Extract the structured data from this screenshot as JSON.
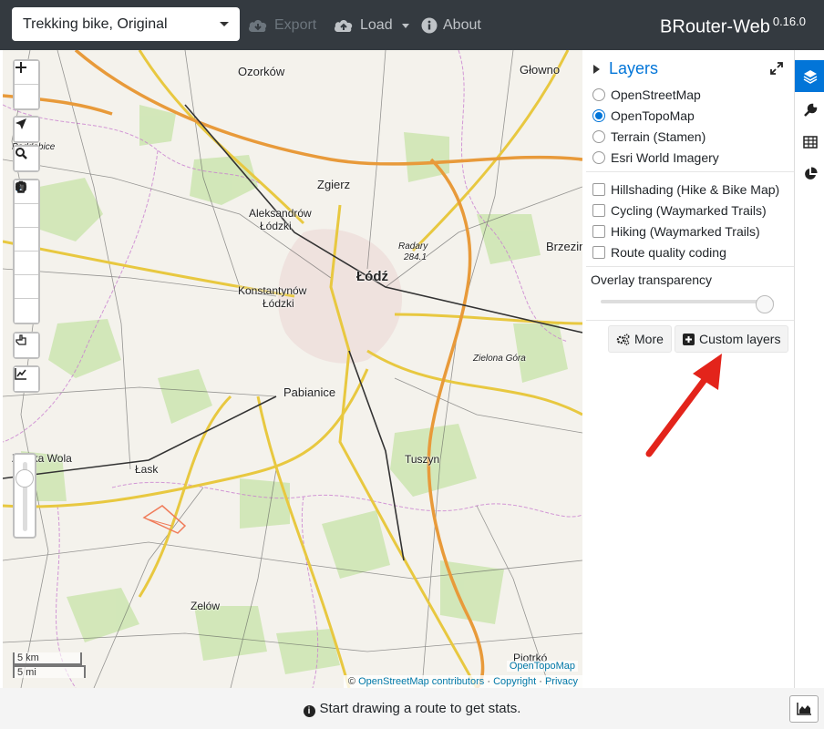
{
  "navbar": {
    "profile": "Trekking bike, Original",
    "export_label": "Export",
    "load_label": "Load",
    "about_label": "About",
    "brand": "BRouter-Web",
    "version": "0.16.0"
  },
  "map": {
    "labels": {
      "ozorkow": "Ozorków",
      "glowno": "Głowno",
      "zgierz": "Zgierz",
      "aleksandrow1": "Aleksandrów",
      "aleksandrow2": "Łódzki",
      "radary1": "Radary",
      "radary2": "284.1",
      "brzezin": "Brzezin",
      "lodz": "Łódź",
      "konstantynow1": "Konstantynów",
      "konstantynow2": "Łódzki",
      "zielona_gora": "Zielona Góra",
      "pabianice": "Pabianice",
      "lask": "Łask",
      "zelska_wola": "Zelska Wola",
      "tuszyn": "Tuszyn",
      "zelow": "Zelów",
      "poddebice": "Poddębice",
      "piotrkow": "Piotrkó"
    },
    "scale_km": "5 km",
    "scale_mi": "5 mi",
    "attribution_topo": "OpenTopoMap",
    "attribution_osm": "OpenStreetMap contributors",
    "attribution_copyright": "Copyright",
    "attribution_privacy": "Privacy",
    "attribution_prefix": "©",
    "attribution_sep": "·"
  },
  "sidebar": {
    "title": "Layers",
    "base_layers": [
      {
        "label": "OpenStreetMap",
        "checked": false
      },
      {
        "label": "OpenTopoMap",
        "checked": true
      },
      {
        "label": "Terrain (Stamen)",
        "checked": false
      },
      {
        "label": "Esri World Imagery",
        "checked": false
      }
    ],
    "overlays": [
      {
        "label": "Hillshading (Hike & Bike Map)"
      },
      {
        "label": "Cycling (Waymarked Trails)"
      },
      {
        "label": "Hiking (Waymarked Trails)"
      },
      {
        "label": "Route quality coding"
      }
    ],
    "overlay_transparency_label": "Overlay transparency",
    "overlay_transparency_value": 1.0,
    "more_label": "More",
    "custom_layers_label": "Custom layers"
  },
  "footer": {
    "message": "Start drawing a route to get stats.",
    "info_glyph": "i"
  },
  "colors": {
    "navbar_bg": "#343a40",
    "accent": "#0275d8",
    "annotation_arrow": "#e3241b"
  }
}
